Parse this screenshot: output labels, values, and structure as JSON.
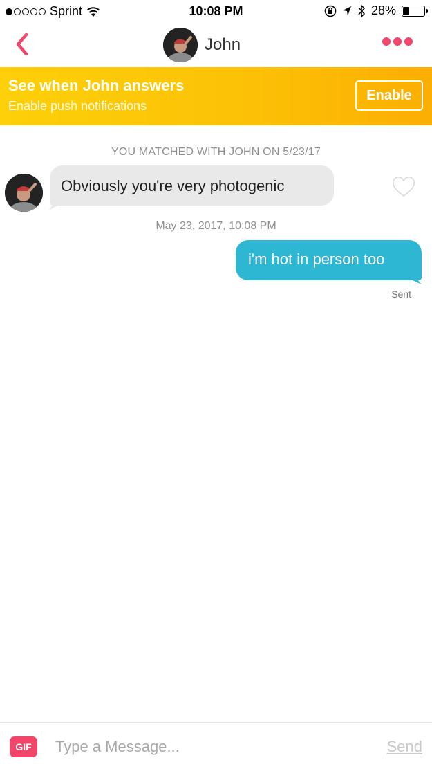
{
  "status_bar": {
    "carrier": "Sprint",
    "time": "10:08 PM",
    "battery_percent": "28%",
    "battery_level": 0.28,
    "signal_bars_filled": 1,
    "signal_bars_total": 5,
    "icons": [
      "wifi-icon",
      "orientation-lock-icon",
      "location-icon",
      "bluetooth-icon",
      "battery-icon"
    ]
  },
  "header": {
    "contact_name": "John",
    "back_icon": "chevron-left-icon",
    "more_icon": "more-dots-icon",
    "accent_color": "#f0466a"
  },
  "banner": {
    "title": "See when John answers",
    "subtitle": "Enable push notifications",
    "button_label": "Enable",
    "color": "#fcc206"
  },
  "conversation": {
    "match_label": "YOU MATCHED WITH JOHN ON 5/23/17",
    "incoming_message": "Obviously you're very photogenic",
    "timestamp": "May 23, 2017, 10:08 PM",
    "outgoing_message": "i'm hot in person too",
    "outgoing_color": "#2db7d3",
    "delivery_status": "Sent"
  },
  "composer": {
    "gif_label": "GIF",
    "placeholder": "Type a Message...",
    "send_label": "Send"
  }
}
